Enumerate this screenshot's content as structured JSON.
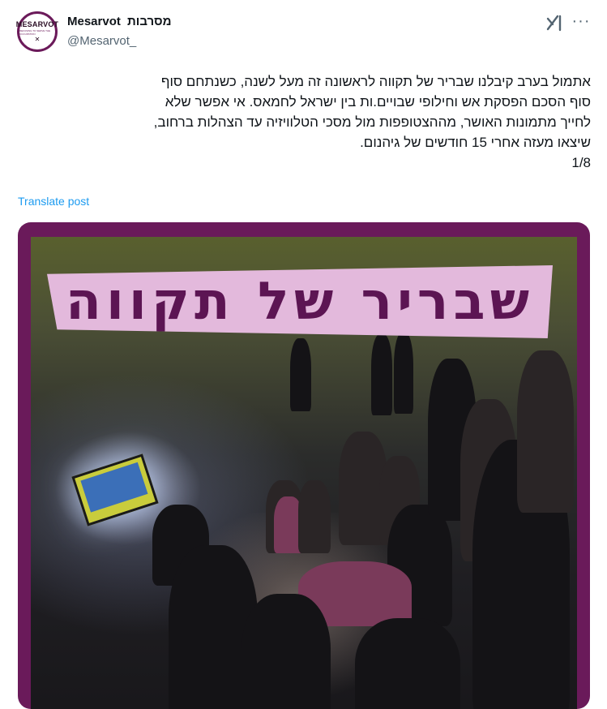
{
  "author": {
    "display_name_en": "Mesarvot",
    "display_name_he": "מסרבות",
    "handle": "@Mesarvot_",
    "avatar_text": "MESARVOT",
    "avatar_subtext": "REFUSING TO SERVE THE OCCUPATION",
    "avatar_mark": "✕"
  },
  "icons": {
    "grok": "grok-icon",
    "more": "more-icon"
  },
  "more_glyph": "···",
  "post": {
    "lines": [
      "אתמול בערב קיבלנו שבריר של תקווה לראשונה זה מעל לשנה, כשנתחם סוף",
      "סוף הסכם הפסקת אש וחילופי שבויים.ות בין ישראל לחמאס. אי אפשר שלא",
      "לחייך מתמונות האושר, מההצטופפות מול מסכי הטלוויזיה עד הצהלות ברחוב,",
      "שיצאו מעזה אחרי 15 חודשים של גיהנום.",
      "1/8"
    ],
    "translate_label": "Translate post"
  },
  "media": {
    "banner_text": "שבריר של תקווה"
  },
  "colors": {
    "brand_purple": "#6a1a5a",
    "banner_bg": "#e3b9dc",
    "banner_text": "#5c1553",
    "link": "#1d9bf0",
    "muted": "#536471"
  }
}
